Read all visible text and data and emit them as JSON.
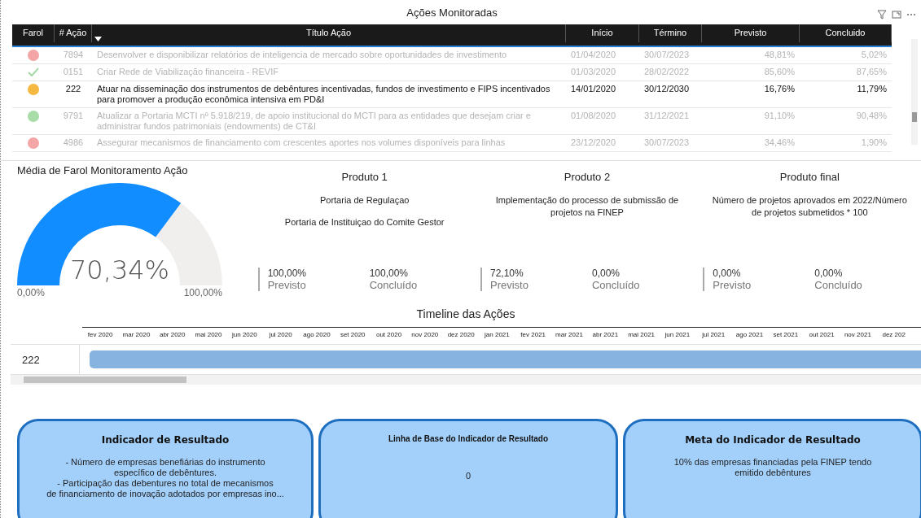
{
  "table": {
    "title": "Ações Monitoradas",
    "columns": [
      "Farol",
      "# Ação",
      "Título Ação",
      "Início",
      "Término",
      "Previsto",
      "Concluido"
    ],
    "rows": [
      {
        "farol": {
          "kind": "dot",
          "color": "#f4a6a6"
        },
        "id": "7894",
        "title": "Desenvolver e disponibilizar relatórios de inteligencia de mercado sobre oportunidades de investimento",
        "start": "01/04/2020",
        "end": "30/07/2023",
        "planned": "48,81%",
        "done": "5,02%",
        "selected": false
      },
      {
        "farol": {
          "kind": "check",
          "color": "#a6d9a6"
        },
        "id": "0151",
        "title": "Criar Rede de Viabilização financeira - REVIF",
        "start": "01/03/2020",
        "end": "28/02/2022",
        "planned": "85,60%",
        "done": "87,65%",
        "selected": false
      },
      {
        "farol": {
          "kind": "dot",
          "color": "#f5b942"
        },
        "id": "222",
        "title": "Atuar na disseminação dos instrumentos de debêntures incentivadas, fundos de investimento e FIPS incentivados para promover a produção econômica intensiva em PD&I",
        "start": "14/01/2020",
        "end": "30/12/2030",
        "planned": "16,76%",
        "done": "11,79%",
        "selected": true
      },
      {
        "farol": {
          "kind": "dot",
          "color": "#a8dca8"
        },
        "id": "9791",
        "title": "Atualizar a Portaria MCTI nº 5.918/219, de apoio institucional do MCTI para as entidades que desejam criar e administrar fundos patrimoniais (endowments) de CT&I",
        "start": "01/08/2020",
        "end": "31/12/2021",
        "planned": "91,10%",
        "done": "90,48%",
        "selected": false
      },
      {
        "farol": {
          "kind": "dot",
          "color": "#f4a6a6"
        },
        "id": "4986",
        "title": "Assegurar mecanismos de financiamento com crescentes aportes nos volumes disponíveis para linhas",
        "start": "23/12/2020",
        "end": "30/07/2023",
        "planned": "34,46%",
        "done": "1,90%",
        "selected": false
      }
    ]
  },
  "gauge": {
    "title": "Média de Farol Monitoramento Ação",
    "value": "70,34%",
    "min": "0,00%",
    "max": "100,00%"
  },
  "products": [
    {
      "title": "Produto 1",
      "descriptions": [
        "Portaria de Regulaçao",
        "Portaria de Instituiçao do Comite Gestor"
      ],
      "planned": "100,00%",
      "planned_label": "Previsto",
      "done": "100,00%",
      "done_label": "Concluído"
    },
    {
      "title": "Produto 2",
      "descriptions": [
        "Implementação do processo de submissão de projetos na FINEP"
      ],
      "planned": "72,10%",
      "planned_label": "Previsto",
      "done": "0,00%",
      "done_label": "Concluído"
    },
    {
      "title": "Produto final",
      "descriptions": [
        "Número de projetos aprovados em 2022/Número de projetos submetidos * 100"
      ],
      "planned": "0,00%",
      "planned_label": "Previsto",
      "done": "0,00%",
      "done_label": "Concluído"
    }
  ],
  "timeline": {
    "title": "Timeline das Ações",
    "months": [
      "fev 2020",
      "mar 2020",
      "abr 2020",
      "mai 2020",
      "jun 2020",
      "jul 2020",
      "ago 2020",
      "set 2020",
      "out 2020",
      "nov 2020",
      "dez 2020",
      "jan 2021",
      "fev 2021",
      "mar 2021",
      "abr 2021",
      "mai 2021",
      "jun 2021",
      "jul 2021",
      "ago 2021",
      "set 2021",
      "out 2021",
      "nov 2021",
      "dez 202"
    ],
    "rows": [
      {
        "label": "222"
      }
    ]
  },
  "cards": [
    {
      "title": "Indicador de Resultado",
      "kind": "normal",
      "lines": [
        "- Número de empresas benefiárias do instrumento",
        "específico de debêntures.",
        "- Participação das debentures no total de mecanismos",
        "de financiamento de inovação adotados por empresas ino..."
      ]
    },
    {
      "title": "Linha de Base do Indicador de Resultado",
      "kind": "small",
      "lines": [
        "0"
      ]
    },
    {
      "title": "Meta do Indicador de Resultado",
      "kind": "normal",
      "lines": [
        "10% das empresas financiadas pela FINEP tendo",
        "emitido debêntures"
      ]
    }
  ]
}
